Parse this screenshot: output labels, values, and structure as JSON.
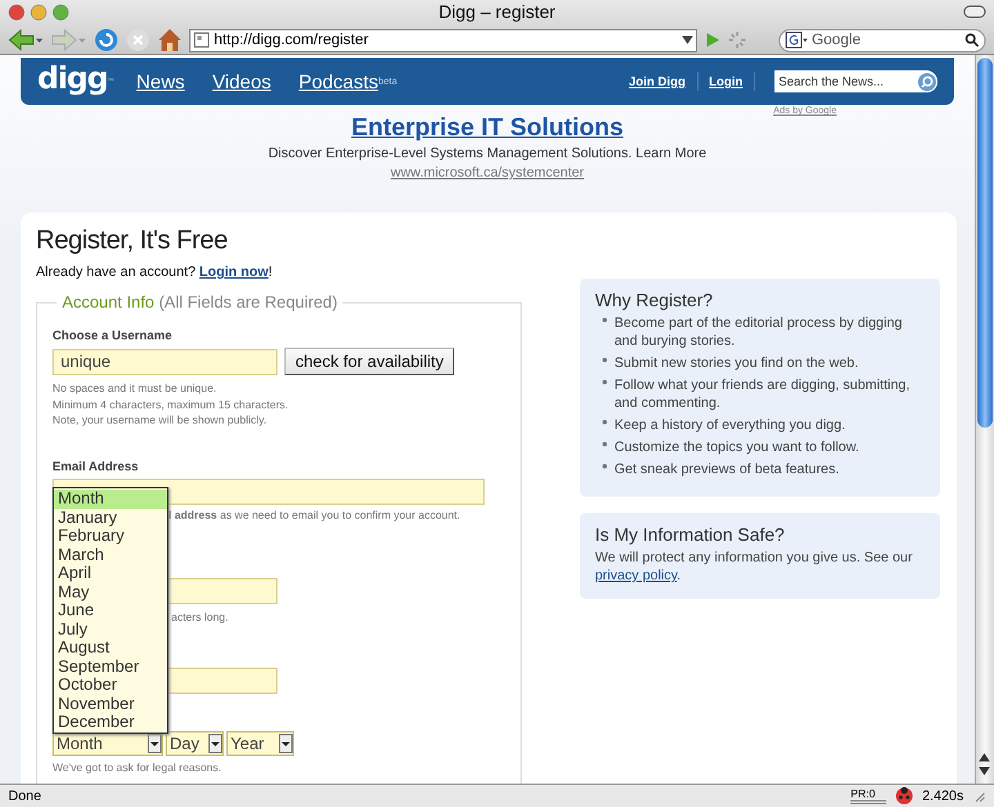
{
  "window": {
    "title": "Digg – register"
  },
  "toolbar": {
    "url": "http://digg.com/register",
    "search_placeholder": "Google"
  },
  "header": {
    "logo": "digg",
    "logo_mark": "™",
    "nav": [
      {
        "label": "News"
      },
      {
        "label": "Videos"
      },
      {
        "label": "Podcasts",
        "badge": "beta"
      }
    ],
    "links": [
      "Join Digg",
      "Login"
    ],
    "search_placeholder": "Search the News..."
  },
  "ad": {
    "credit": "Ads by Google",
    "title": "Enterprise IT Solutions",
    "text": "Discover Enterprise-Level Systems Management Solutions. Learn More",
    "url": "www.microsoft.ca/systemcenter"
  },
  "form": {
    "title": "Register, It's Free",
    "login_prompt": "Already have an account?",
    "login_link": "Login now",
    "login_suffix": "!",
    "legend": "Account Info",
    "legend_note": "(All Fields are Required)",
    "username": {
      "label": "Choose a Username",
      "value": "unique",
      "button": "check for availability",
      "hints": [
        "No spaces and it must be unique.",
        "Minimum 4 characters, maximum 15 characters.",
        "Note, your username will be shown publicly."
      ]
    },
    "email": {
      "label": "Email Address",
      "hint": "**l address** as we need to email you to confirm your account."
    },
    "password": {
      "hint": "acters long."
    },
    "birthday": {
      "selects": [
        {
          "kind": "month",
          "value": "Month"
        },
        {
          "kind": "day",
          "value": "Day"
        },
        {
          "kind": "year",
          "value": "Year"
        }
      ],
      "menu": [
        {
          "label": "Month",
          "selected": true
        },
        {
          "label": "January",
          "selected": false
        },
        {
          "label": "February",
          "selected": false
        },
        {
          "label": "March",
          "selected": false
        },
        {
          "label": "April",
          "selected": false
        },
        {
          "label": "May",
          "selected": false
        },
        {
          "label": "June",
          "selected": false
        },
        {
          "label": "July",
          "selected": false
        },
        {
          "label": "August",
          "selected": false
        },
        {
          "label": "September",
          "selected": false
        },
        {
          "label": "October",
          "selected": false
        },
        {
          "label": "November",
          "selected": false
        },
        {
          "label": "December",
          "selected": false
        }
      ],
      "hint": "We've got to ask for legal reasons."
    }
  },
  "sidebar": {
    "why": {
      "title": "Why Register?",
      "items": [
        "Become part of the editorial process by digging and burying stories.",
        "Submit new stories you find on the web.",
        "Follow what your friends are digging, submitting, and commenting.",
        "Keep a history of everything you digg.",
        "Customize the topics you want to follow.",
        "Get sneak previews of beta features."
      ]
    },
    "safe": {
      "title": "Is My Information Safe?",
      "text": "We will protect any information you give us. See our",
      "link": "privacy policy",
      "suffix": "."
    }
  },
  "status_bar": {
    "text": "Done",
    "pagerank": "PR:0",
    "timing": "2.420s"
  }
}
